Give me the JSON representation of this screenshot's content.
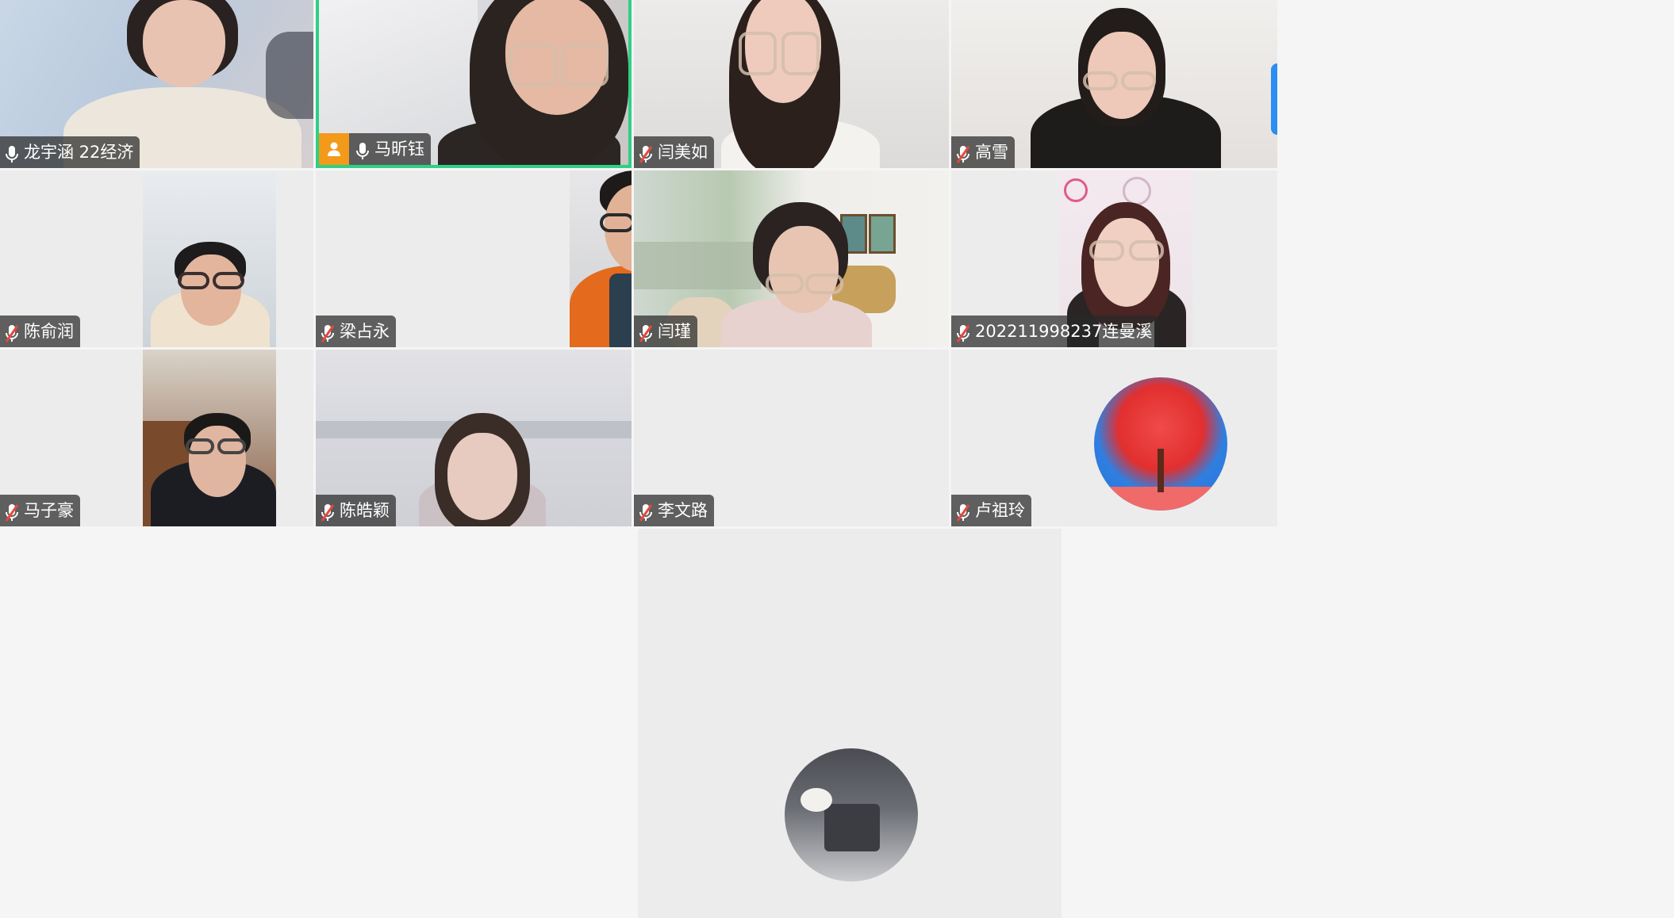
{
  "participants": [
    {
      "name": "龙宇涵 22经济",
      "mic": "on"
    },
    {
      "name": "马昕钰",
      "mic": "on",
      "host": true,
      "speaking": true
    },
    {
      "name": "闫美如",
      "mic": "muted"
    },
    {
      "name": "高雪",
      "mic": "muted"
    },
    {
      "name": "陈俞润",
      "mic": "muted"
    },
    {
      "name": "梁占永",
      "mic": "muted"
    },
    {
      "name": "闫瑾",
      "mic": "muted"
    },
    {
      "name": "202211998237连曼溪",
      "mic": "muted"
    },
    {
      "name": "马子豪",
      "mic": "muted"
    },
    {
      "name": "陈皓颖",
      "mic": "muted"
    },
    {
      "name": "李文路",
      "mic": "muted"
    },
    {
      "name": "卢祖玲",
      "mic": "muted"
    }
  ],
  "colors": {
    "speaking_border": "#2fcf86",
    "host_badge": "#f39a1a",
    "name_badge_bg": "#282828b8",
    "muted_slash": "#e8483d",
    "side_tab": "#2b8ef0"
  },
  "icons": {
    "mic_on": "microphone-icon",
    "mic_muted": "microphone-muted-icon",
    "host": "host-person-icon"
  }
}
